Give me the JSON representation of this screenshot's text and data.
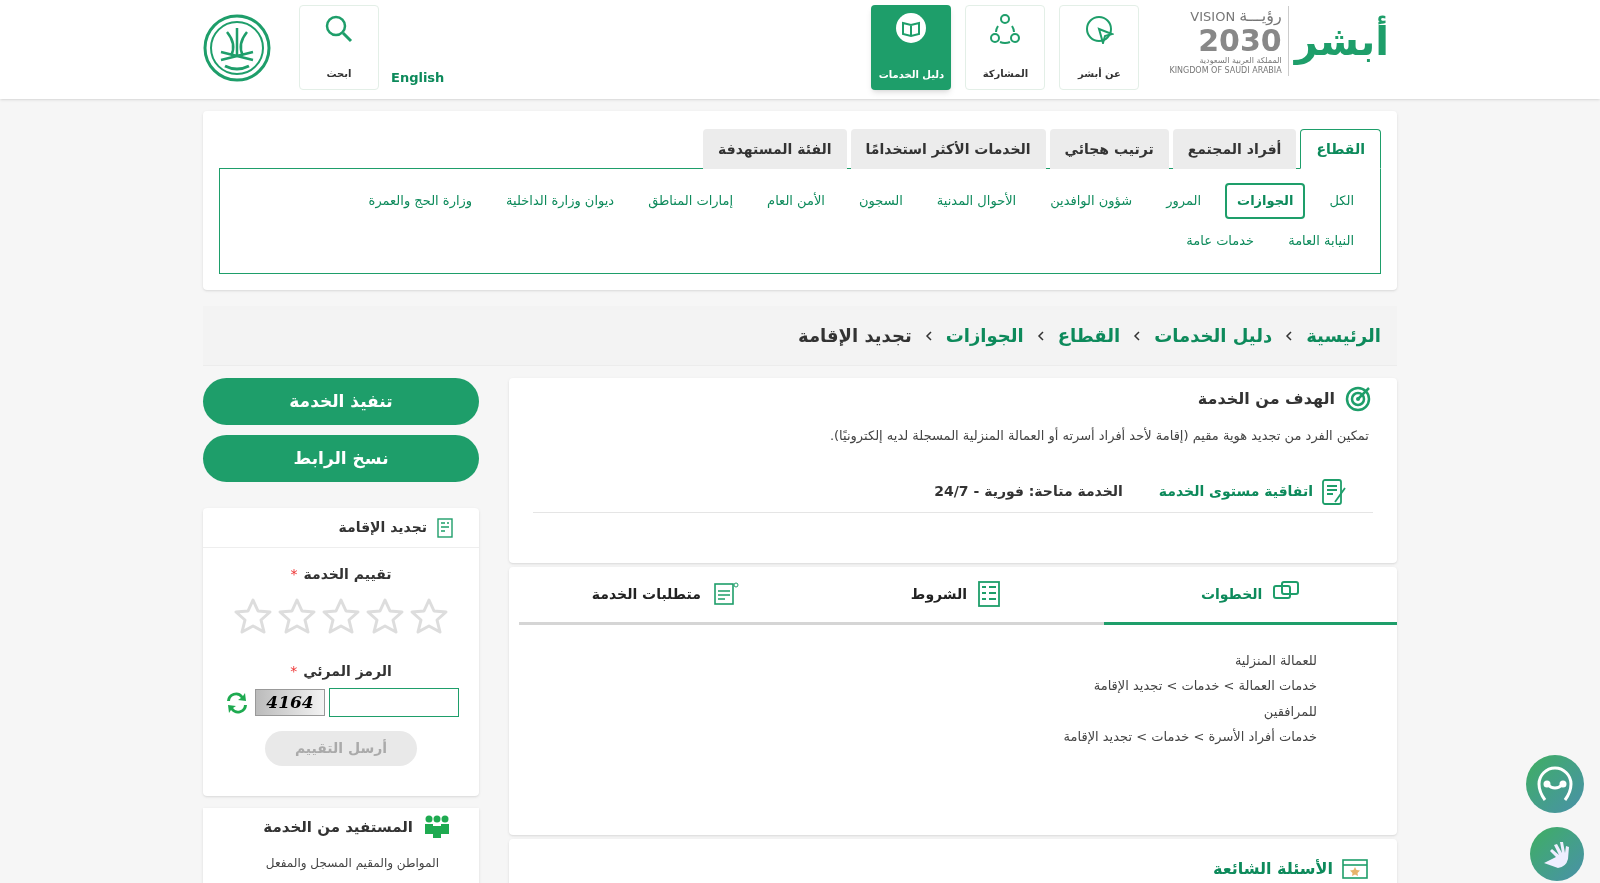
{
  "header": {
    "logo": {
      "brand": "أبشر",
      "vision_arabic": "رؤيـــة",
      "vision": "VISION",
      "year": "2030",
      "country_arabic": "المملكة العربية السعودية",
      "country": "KINGDOM OF SAUDI ARABIA"
    },
    "nav": [
      {
        "label": "عن أبشر",
        "selected": false
      },
      {
        "label": "المشاركة",
        "selected": false
      },
      {
        "label": "دليل الخدمات",
        "selected": true
      }
    ],
    "language": "English",
    "search": "ابحث"
  },
  "sector_tabs": [
    {
      "label": "القطاع",
      "selected": true
    },
    {
      "label": "أفراد المجتمع",
      "selected": false
    },
    {
      "label": "ترتيب هجائي",
      "selected": false
    },
    {
      "label": "الخدمات الأكثر استخدامًا",
      "selected": false
    },
    {
      "label": "الفئة المستهدفة",
      "selected": false
    }
  ],
  "sectors": [
    {
      "label": "الكل",
      "selected": false
    },
    {
      "label": "الجوازات",
      "selected": true
    },
    {
      "label": "المرور",
      "selected": false
    },
    {
      "label": "شؤون الوافدين",
      "selected": false
    },
    {
      "label": "الأحوال المدنية",
      "selected": false
    },
    {
      "label": "السجون",
      "selected": false
    },
    {
      "label": "الأمن العام",
      "selected": false
    },
    {
      "label": "إمارات المناطق",
      "selected": false
    },
    {
      "label": "ديوان وزارة الداخلية",
      "selected": false
    },
    {
      "label": "وزارة الحج والعمرة",
      "selected": false
    },
    {
      "label": "النيابة العامة",
      "selected": false
    },
    {
      "label": "خدمات عامة",
      "selected": false
    }
  ],
  "breadcrumb": [
    {
      "label": "الرئيسية",
      "selected": false
    },
    {
      "label": "دليل الخدمات",
      "selected": false
    },
    {
      "label": "القطاع",
      "selected": false
    },
    {
      "label": "الجوازات",
      "selected": false
    },
    {
      "label": "تجديد الإقامة",
      "selected": true
    }
  ],
  "goal": {
    "title": "الهدف من الخدمة",
    "description": "تمكين الفرد من تجديد هوية مقيم (إقامة لأحد أفراد أسرته أو العمالة المنزلية المسجلة لديه إلكترونيًا).",
    "sla": "اتفاقية مستوى الخدمة",
    "availability": "الخدمة متاحة: فورية - 24/7"
  },
  "detail_tabs": [
    {
      "label": "الخطوات",
      "selected": true
    },
    {
      "label": "الشروط",
      "selected": false
    },
    {
      "label": "متطلبات الخدمة",
      "selected": false
    }
  ],
  "steps": [
    "للعمالة المنزلية",
    "خدمات العمالة > خدمات > تجديد الإقامة",
    "للمرافقين",
    "خدمات أفراد الأسرة > خدمات > تجديد الإقامة"
  ],
  "faq": {
    "title": "الأسئلة الشائعة"
  },
  "actions": [
    "تنفيذ الخدمة",
    "نسخ الرابط"
  ],
  "rating_card": {
    "title": "تجديد الإقامة",
    "rating_label": "تقييم الخدمة",
    "rating_required_mark": "*",
    "stars": 0,
    "captcha_label": "الرمز المرئي",
    "captcha_required_mark": "*",
    "captcha_code": "4164",
    "submit": "أرسل التقييم",
    "submit_disabled": true
  },
  "beneficiary": {
    "title": "المستفيد من الخدمة",
    "text": "المواطن والمقيم المسجل والمفعل"
  }
}
